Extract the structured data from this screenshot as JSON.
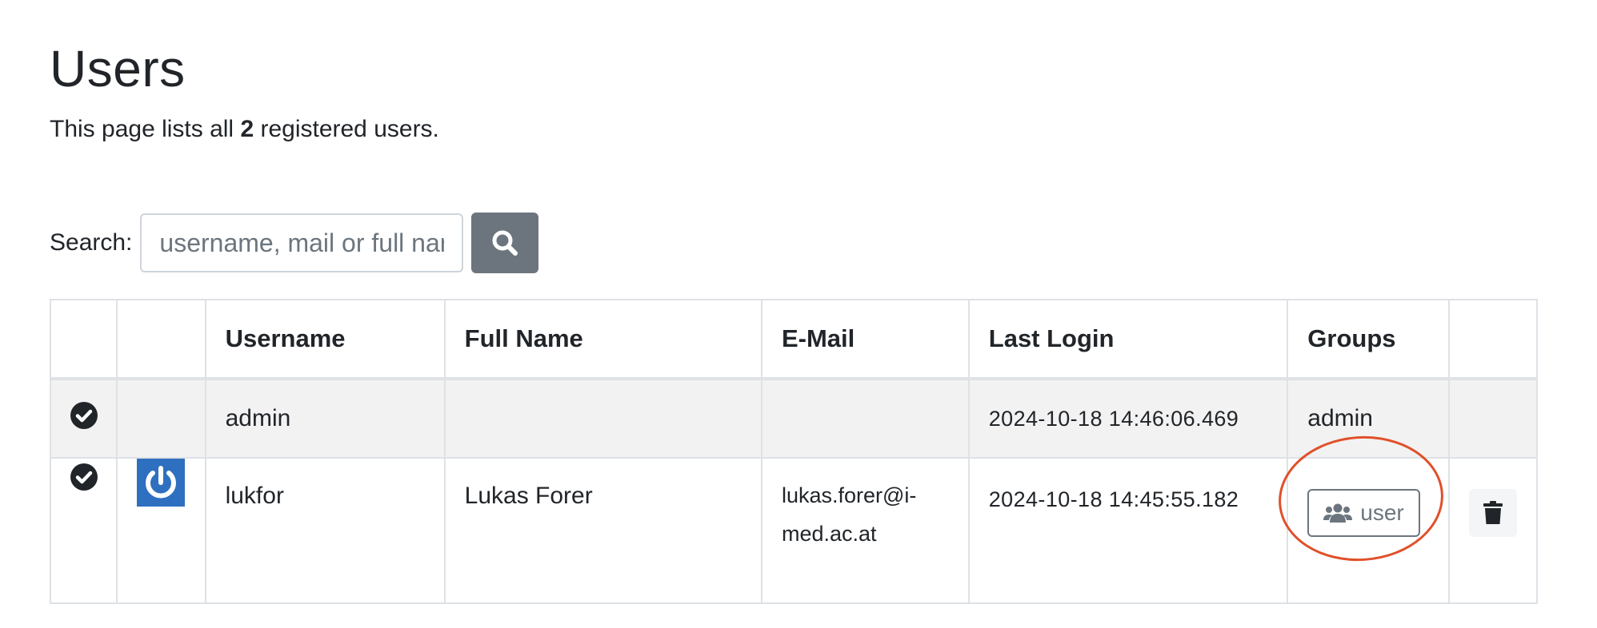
{
  "page": {
    "title": "Users",
    "subtitle_prefix": "This page lists all ",
    "user_count": "2",
    "subtitle_suffix": " registered users."
  },
  "search": {
    "label": "Search:",
    "placeholder": "username, mail or full name",
    "button_icon": "search-icon"
  },
  "table": {
    "headers": [
      "",
      "",
      "Username",
      "Full Name",
      "E-Mail",
      "Last Login",
      "Groups",
      ""
    ],
    "rows": [
      {
        "status_icon": "check-circle-icon",
        "avatar": "",
        "username": "admin",
        "full_name": "",
        "email": "",
        "last_login": "2024-10-18 14:46:06.469",
        "groups": "admin"
      },
      {
        "status_icon": "check-circle-icon",
        "avatar": "power-avatar-icon",
        "username": "lukfor",
        "full_name": "Lukas Forer",
        "email": "lukas.forer@i-med.ac.at",
        "last_login": "2024-10-18 14:45:55.182",
        "groups_button_label": "user",
        "groups_button_icon": "users-icon",
        "delete_icon": "trash-icon"
      }
    ]
  },
  "colors": {
    "search_button_bg": "#6c757d",
    "avatar_bg": "#2f6fbf",
    "highlight_circle": "#e0502a"
  }
}
